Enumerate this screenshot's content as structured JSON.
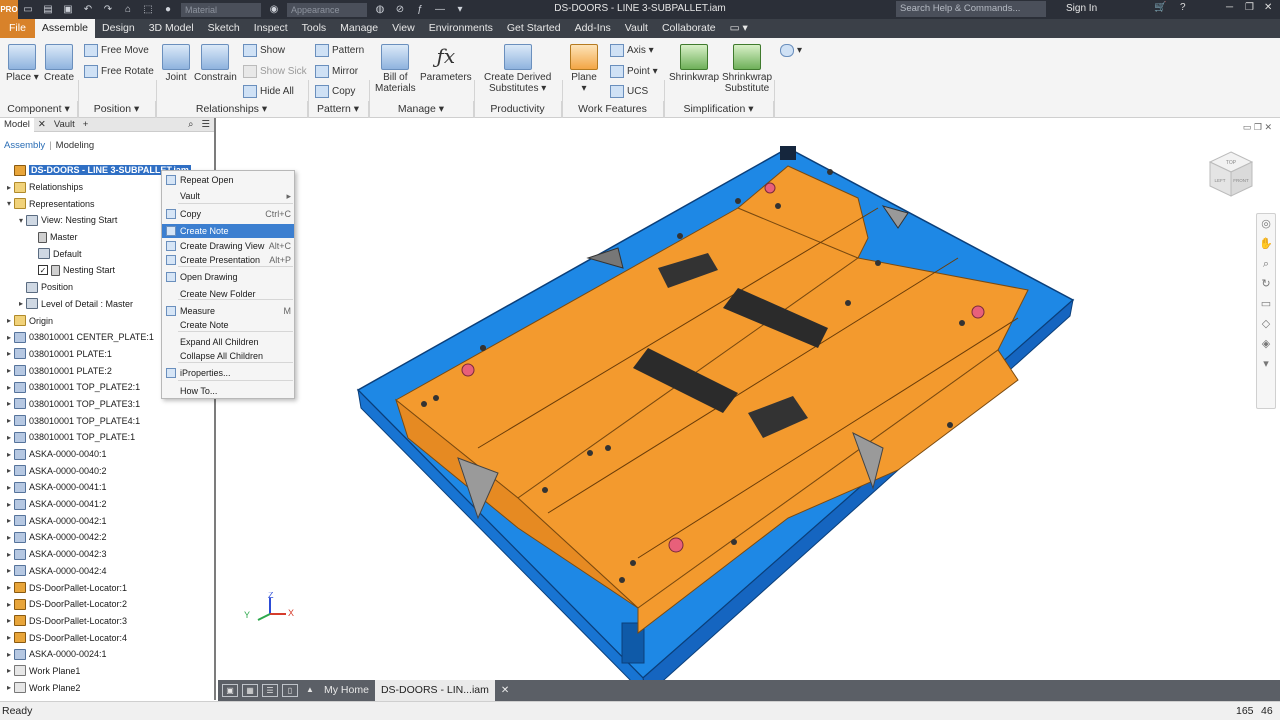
{
  "title_bar": {
    "app_logo": "PRO",
    "material_placeholder": "Material",
    "appearance_placeholder": "Appearance",
    "document_title": "DS-DOORS - LINE 3-SUBPALLET.iam",
    "search_placeholder": "Search Help & Commands...",
    "sign_in": "Sign In",
    "icons": [
      "new-icon",
      "open-icon",
      "save-icon",
      "undo-icon",
      "redo-icon",
      "home-icon",
      "select-icon",
      "material-icon",
      "appearance-icon",
      "cart-icon",
      "help-icon",
      "minimize-icon",
      "restore-icon",
      "close-icon"
    ]
  },
  "menu_tabs": [
    "File",
    "Assemble",
    "Design",
    "3D Model",
    "Sketch",
    "Inspect",
    "Tools",
    "Manage",
    "View",
    "Environments",
    "Get Started",
    "Add-Ins",
    "Vault",
    "Collaborate"
  ],
  "active_tab": "Assemble",
  "ribbon": {
    "component": {
      "place": "Place",
      "create": "Create",
      "panel": "Component"
    },
    "position": {
      "free_move": "Free Move",
      "free_rotate": "Free Rotate",
      "panel": "Position"
    },
    "relationships": {
      "joint": "Joint",
      "constrain": "Constrain",
      "show": "Show",
      "show_sick": "Show Sick",
      "hide_all": "Hide All",
      "panel": "Relationships"
    },
    "pattern": {
      "pattern": "Pattern",
      "mirror": "Mirror",
      "copy": "Copy",
      "panel": "Pattern"
    },
    "manage": {
      "bom_line1": "Bill of",
      "bom_line2": "Materials",
      "parameters": "Parameters",
      "panel": "Manage"
    },
    "productivity": {
      "cds_line1": "Create Derived",
      "cds_line2": "Substitutes",
      "panel": "Productivity"
    },
    "work_features": {
      "plane": "Plane",
      "axis": "Axis",
      "point": "Point",
      "ucs": "UCS",
      "panel": "Work Features"
    },
    "simplification": {
      "shrinkwrap": "Shrinkwrap",
      "sws_line1": "Shrinkwrap",
      "sws_line2": "Substitute",
      "panel": "Simplification"
    }
  },
  "browser": {
    "tabs": [
      "Model",
      "Vault"
    ],
    "modes": {
      "assembly": "Assembly",
      "modeling": "Modeling"
    },
    "tree": [
      {
        "label": "DS-DOORS - LINE 3-SUBPALLET.iam",
        "icon": "assembly",
        "indent": 0,
        "exp": "",
        "selected": true
      },
      {
        "label": "Relationships",
        "icon": "folder",
        "indent": 0,
        "exp": "▸"
      },
      {
        "label": "Representations",
        "icon": "folder",
        "indent": 0,
        "exp": "▾"
      },
      {
        "label": "View: Nesting Start",
        "icon": "view",
        "indent": 1,
        "exp": "▾"
      },
      {
        "label": "Master",
        "icon": "lock",
        "indent": 2,
        "exp": ""
      },
      {
        "label": "Default",
        "icon": "view",
        "indent": 2,
        "exp": ""
      },
      {
        "label": "Nesting Start",
        "icon": "lock",
        "indent": 2,
        "exp": "",
        "checked": true
      },
      {
        "label": "Position",
        "icon": "view",
        "indent": 1,
        "exp": ""
      },
      {
        "label": "Level of Detail : Master",
        "icon": "view",
        "indent": 1,
        "exp": "▸"
      },
      {
        "label": "Origin",
        "icon": "folder",
        "indent": 0,
        "exp": "▸"
      },
      {
        "label": "038010001 CENTER_PLATE:1",
        "icon": "part",
        "indent": 0,
        "exp": "▸"
      },
      {
        "label": "038010001 PLATE:1",
        "icon": "part",
        "indent": 0,
        "exp": "▸"
      },
      {
        "label": "038010001 PLATE:2",
        "icon": "part",
        "indent": 0,
        "exp": "▸"
      },
      {
        "label": "038010001 TOP_PLATE2:1",
        "icon": "part",
        "indent": 0,
        "exp": "▸"
      },
      {
        "label": "038010001 TOP_PLATE3:1",
        "icon": "part",
        "indent": 0,
        "exp": "▸"
      },
      {
        "label": "038010001 TOP_PLATE4:1",
        "icon": "part",
        "indent": 0,
        "exp": "▸"
      },
      {
        "label": "038010001 TOP_PLATE:1",
        "icon": "part",
        "indent": 0,
        "exp": "▸"
      },
      {
        "label": "ASKA-0000-0040:1",
        "icon": "part",
        "indent": 0,
        "exp": "▸"
      },
      {
        "label": "ASKA-0000-0040:2",
        "icon": "part",
        "indent": 0,
        "exp": "▸"
      },
      {
        "label": "ASKA-0000-0041:1",
        "icon": "part",
        "indent": 0,
        "exp": "▸"
      },
      {
        "label": "ASKA-0000-0041:2",
        "icon": "part",
        "indent": 0,
        "exp": "▸"
      },
      {
        "label": "ASKA-0000-0042:1",
        "icon": "part",
        "indent": 0,
        "exp": "▸"
      },
      {
        "label": "ASKA-0000-0042:2",
        "icon": "part",
        "indent": 0,
        "exp": "▸"
      },
      {
        "label": "ASKA-0000-0042:3",
        "icon": "part",
        "indent": 0,
        "exp": "▸"
      },
      {
        "label": "ASKA-0000-0042:4",
        "icon": "part",
        "indent": 0,
        "exp": "▸"
      },
      {
        "label": "DS-DoorPallet-Locator:1",
        "icon": "assembly",
        "indent": 0,
        "exp": "▸"
      },
      {
        "label": "DS-DoorPallet-Locator:2",
        "icon": "assembly",
        "indent": 0,
        "exp": "▸"
      },
      {
        "label": "DS-DoorPallet-Locator:3",
        "icon": "assembly",
        "indent": 0,
        "exp": "▸"
      },
      {
        "label": "DS-DoorPallet-Locator:4",
        "icon": "assembly",
        "indent": 0,
        "exp": "▸"
      },
      {
        "label": "ASKA-0000-0024:1",
        "icon": "part",
        "indent": 0,
        "exp": "▸"
      },
      {
        "label": "Work Plane1",
        "icon": "plane",
        "indent": 0,
        "exp": "▸"
      },
      {
        "label": "Work Plane2",
        "icon": "plane",
        "indent": 0,
        "exp": "▸"
      }
    ]
  },
  "context_menu": [
    {
      "label": "Repeat Open",
      "shortcut": "",
      "icon": true
    },
    {
      "label": "Vault",
      "shortcut": "▸",
      "icon": false
    },
    {
      "label": "Copy",
      "shortcut": "Ctrl+C",
      "icon": true
    },
    {
      "label": "Create Note",
      "shortcut": "",
      "icon": true,
      "highlight": true
    },
    {
      "label": "Create Drawing View",
      "shortcut": "Alt+C",
      "icon": true
    },
    {
      "label": "Create Presentation",
      "shortcut": "Alt+P",
      "icon": true
    },
    {
      "label": "Open Drawing",
      "shortcut": "",
      "icon": true
    },
    {
      "label": "Create New Folder",
      "shortcut": "",
      "icon": false
    },
    {
      "label": "Measure",
      "shortcut": "M",
      "icon": true
    },
    {
      "label": "Create Note",
      "shortcut": "",
      "icon": false
    },
    {
      "label": "Expand All Children",
      "shortcut": "",
      "icon": false
    },
    {
      "label": "Collapse All Children",
      "shortcut": "",
      "icon": false
    },
    {
      "label": "iProperties...",
      "shortcut": "",
      "icon": true
    },
    {
      "label": "How To...",
      "shortcut": "",
      "icon": false
    }
  ],
  "viewcube": {
    "top": "TOP",
    "left": "LEFT",
    "front": "FRONT"
  },
  "axis_triad": {
    "x": "X",
    "y": "Y",
    "z": "Z"
  },
  "document_tabs": {
    "home": "My Home",
    "doc": "DS-DOORS - LIN...iam"
  },
  "status_bar": {
    "text": "Ready",
    "count1": "165",
    "count2": "46"
  },
  "colors": {
    "accent": "#d8822a",
    "plate": "#f39a2e",
    "frame": "#1e88e5",
    "dark": "#2b2f38"
  }
}
